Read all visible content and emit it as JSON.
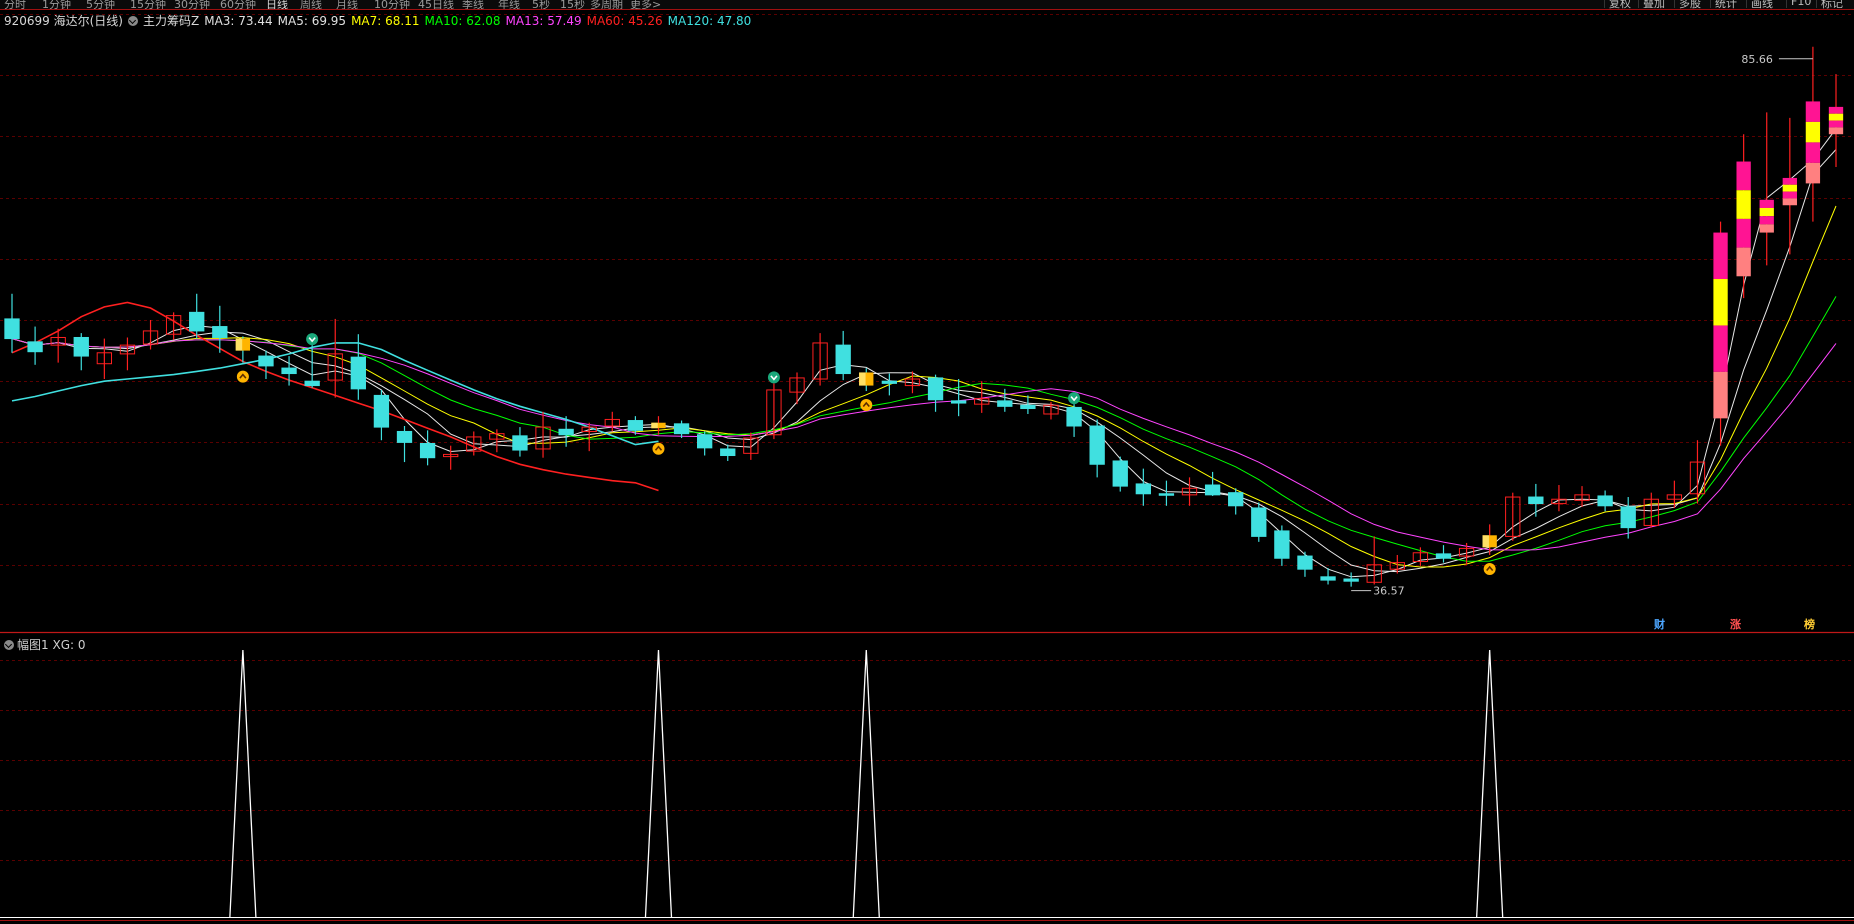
{
  "toolbar": {
    "periods": [
      "分时",
      "1分钟",
      "5分钟",
      "15分钟",
      "30分钟",
      "60分钟",
      "日线",
      "周线",
      "月线",
      "10分钟",
      "45日线",
      "季线",
      "年线",
      "5秒",
      "15秒",
      "多周期",
      "更多>"
    ],
    "active_period": "日线",
    "right_buttons": [
      "复权",
      "叠加",
      "多股",
      "统计",
      "画线",
      "F10",
      "标记"
    ]
  },
  "legend": {
    "stock": "920699 海达尔(日线)",
    "indicator": "主力筹码Z",
    "ma": [
      {
        "label": "MA3: 73.44",
        "color": "#e0e0e0"
      },
      {
        "label": "MA5: 69.95",
        "color": "#e0e0e0"
      },
      {
        "label": "MA7: 68.11",
        "color": "#ffff00"
      },
      {
        "label": "MA10: 62.08",
        "color": "#00ff00"
      },
      {
        "label": "MA13: 57.49",
        "color": "#ff44ff"
      },
      {
        "label": "MA60: 45.26",
        "color": "#ff2020"
      },
      {
        "label": "MA120: 47.80",
        "color": "#40e0e0"
      }
    ]
  },
  "sub_legend": {
    "title": "幅图1",
    "value": "XG: 0"
  },
  "tags": [
    {
      "text": "财",
      "color": "#4da6ff"
    },
    {
      "text": "涨",
      "color": "#ff5050"
    },
    {
      "text": "榜",
      "color": "#ffcc33"
    }
  ],
  "chart_data": [
    {
      "type": "candlestick",
      "title": "920699 海达尔(日线)",
      "ylim": [
        33,
        89
      ],
      "max_label": "85.66",
      "min_label": "36.57",
      "series": [
        {
          "name": "MA60",
          "color": "#ff2020",
          "values": [
            58.0,
            58.9,
            60.0,
            61.3,
            62.2,
            62.6,
            62.1,
            60.9,
            59.6,
            58.4,
            57.2,
            56.3,
            55.5,
            54.8,
            54.1,
            53.4,
            52.7,
            51.9,
            51.1,
            50.3,
            49.4,
            48.5,
            47.8,
            47.3,
            46.9,
            46.6,
            46.3,
            46.1,
            45.4
          ]
        },
        {
          "name": "MA120",
          "color": "#40e0e0",
          "values": [
            53.6,
            54.0,
            54.5,
            55.0,
            55.4,
            55.6,
            55.8,
            56.0,
            56.3,
            56.6,
            57.0,
            57.4,
            57.9,
            58.5,
            58.9,
            58.9,
            58.3,
            57.3,
            56.4,
            55.5,
            54.6,
            53.8,
            53.1,
            52.5,
            51.9,
            51.2,
            50.4,
            49.6,
            49.9
          ]
        }
      ],
      "candles": [
        {
          "o": 61.1,
          "h": 63.4,
          "l": 58.0,
          "c": 59.3
        },
        {
          "o": 59.0,
          "h": 60.4,
          "l": 56.9,
          "c": 58.1
        },
        {
          "o": 58.7,
          "h": 60.2,
          "l": 57.1,
          "c": 59.4
        },
        {
          "o": 59.4,
          "h": 59.8,
          "l": 56.4,
          "c": 57.7
        },
        {
          "o": 57.0,
          "h": 59.3,
          "l": 55.6,
          "c": 58.0
        },
        {
          "o": 57.9,
          "h": 59.4,
          "l": 56.4,
          "c": 58.7
        },
        {
          "o": 58.8,
          "h": 61.0,
          "l": 58.3,
          "c": 60.0
        },
        {
          "o": 59.7,
          "h": 61.7,
          "l": 59.2,
          "c": 61.4
        },
        {
          "o": 61.7,
          "h": 63.4,
          "l": 59.3,
          "c": 60.0
        },
        {
          "o": 60.4,
          "h": 62.3,
          "l": 58.0,
          "c": 59.4
        },
        {
          "o": 59.3,
          "h": 59.5,
          "l": 57.1,
          "c": 58.2
        },
        {
          "o": 57.7,
          "h": 58.2,
          "l": 55.6,
          "c": 56.8
        },
        {
          "o": 56.6,
          "h": 57.7,
          "l": 55.0,
          "c": 56.1
        },
        {
          "o": 55.4,
          "h": 58.7,
          "l": 54.8,
          "c": 55.0
        },
        {
          "o": 55.5,
          "h": 61.1,
          "l": 53.9,
          "c": 57.9
        },
        {
          "o": 57.6,
          "h": 59.7,
          "l": 53.7,
          "c": 54.7
        },
        {
          "o": 54.1,
          "h": 54.6,
          "l": 50.0,
          "c": 51.2
        },
        {
          "o": 50.8,
          "h": 51.3,
          "l": 48.0,
          "c": 49.8
        },
        {
          "o": 49.7,
          "h": 50.9,
          "l": 47.7,
          "c": 48.4
        },
        {
          "o": 48.5,
          "h": 49.5,
          "l": 47.3,
          "c": 48.7
        },
        {
          "o": 49.0,
          "h": 50.8,
          "l": 48.6,
          "c": 50.3
        },
        {
          "o": 50.1,
          "h": 51.0,
          "l": 48.9,
          "c": 50.6
        },
        {
          "o": 50.4,
          "h": 51.2,
          "l": 48.5,
          "c": 49.1
        },
        {
          "o": 49.2,
          "h": 52.6,
          "l": 48.4,
          "c": 51.2
        },
        {
          "o": 51.0,
          "h": 52.2,
          "l": 49.4,
          "c": 50.5
        },
        {
          "o": 50.8,
          "h": 51.6,
          "l": 49.0,
          "c": 51.2
        },
        {
          "o": 51.3,
          "h": 52.6,
          "l": 50.8,
          "c": 51.9
        },
        {
          "o": 51.8,
          "h": 52.2,
          "l": 50.5,
          "c": 50.9
        },
        {
          "o": 51.1,
          "h": 52.2,
          "l": 50.5,
          "c": 51.6
        },
        {
          "o": 51.5,
          "h": 51.8,
          "l": 50.2,
          "c": 50.6
        },
        {
          "o": 50.5,
          "h": 50.8,
          "l": 48.6,
          "c": 49.3
        },
        {
          "o": 49.2,
          "h": 49.6,
          "l": 48.1,
          "c": 48.6
        },
        {
          "o": 48.8,
          "h": 50.7,
          "l": 48.2,
          "c": 50.2
        },
        {
          "o": 50.5,
          "h": 55.2,
          "l": 50.1,
          "c": 54.6
        },
        {
          "o": 54.4,
          "h": 56.2,
          "l": 53.3,
          "c": 55.7
        },
        {
          "o": 55.6,
          "h": 59.8,
          "l": 55.0,
          "c": 58.9
        },
        {
          "o": 58.7,
          "h": 60.0,
          "l": 55.5,
          "c": 56.1
        },
        {
          "o": 56.2,
          "h": 56.6,
          "l": 54.5,
          "c": 55.0
        },
        {
          "o": 55.4,
          "h": 56.1,
          "l": 54.1,
          "c": 55.2
        },
        {
          "o": 55.0,
          "h": 56.3,
          "l": 54.3,
          "c": 55.6
        },
        {
          "o": 55.7,
          "h": 56.0,
          "l": 52.6,
          "c": 53.7
        },
        {
          "o": 53.6,
          "h": 55.6,
          "l": 52.2,
          "c": 53.4
        },
        {
          "o": 53.3,
          "h": 55.4,
          "l": 52.5,
          "c": 53.8
        },
        {
          "o": 53.6,
          "h": 54.7,
          "l": 52.6,
          "c": 53.1
        },
        {
          "o": 53.2,
          "h": 54.1,
          "l": 52.4,
          "c": 52.9
        },
        {
          "o": 52.4,
          "h": 53.5,
          "l": 51.9,
          "c": 53.2
        },
        {
          "o": 53.0,
          "h": 53.3,
          "l": 50.3,
          "c": 51.3
        },
        {
          "o": 51.3,
          "h": 51.9,
          "l": 46.6,
          "c": 47.8
        },
        {
          "o": 48.1,
          "h": 48.5,
          "l": 45.3,
          "c": 45.8
        },
        {
          "o": 46.0,
          "h": 47.4,
          "l": 44.0,
          "c": 45.1
        },
        {
          "o": 45.1,
          "h": 46.3,
          "l": 44.0,
          "c": 45.0
        },
        {
          "o": 45.0,
          "h": 46.6,
          "l": 44.0,
          "c": 45.6
        },
        {
          "o": 45.9,
          "h": 47.1,
          "l": 44.9,
          "c": 45.0
        },
        {
          "o": 45.2,
          "h": 45.6,
          "l": 43.2,
          "c": 44.0
        },
        {
          "o": 43.8,
          "h": 44.3,
          "l": 40.7,
          "c": 41.2
        },
        {
          "o": 41.7,
          "h": 42.2,
          "l": 38.5,
          "c": 39.2
        },
        {
          "o": 39.4,
          "h": 39.8,
          "l": 37.5,
          "c": 38.2
        },
        {
          "o": 37.5,
          "h": 38.3,
          "l": 36.8,
          "c": 37.2
        },
        {
          "o": 37.3,
          "h": 37.9,
          "l": 36.6,
          "c": 37.1
        },
        {
          "o": 37.0,
          "h": 41.2,
          "l": 36.8,
          "c": 38.6
        },
        {
          "o": 38.2,
          "h": 39.5,
          "l": 37.8,
          "c": 38.8
        },
        {
          "o": 38.9,
          "h": 40.2,
          "l": 38.5,
          "c": 39.7
        },
        {
          "o": 39.6,
          "h": 40.4,
          "l": 38.8,
          "c": 39.2
        },
        {
          "o": 39.4,
          "h": 40.6,
          "l": 38.6,
          "c": 40.1
        },
        {
          "o": 40.2,
          "h": 42.3,
          "l": 39.5,
          "c": 41.3
        },
        {
          "o": 41.2,
          "h": 45.2,
          "l": 40.8,
          "c": 44.8
        },
        {
          "o": 44.8,
          "h": 46.0,
          "l": 43.0,
          "c": 44.2
        },
        {
          "o": 44.2,
          "h": 45.9,
          "l": 43.5,
          "c": 44.6
        },
        {
          "o": 44.5,
          "h": 45.8,
          "l": 43.9,
          "c": 45.0
        },
        {
          "o": 44.9,
          "h": 45.4,
          "l": 43.5,
          "c": 44.0
        },
        {
          "o": 43.9,
          "h": 44.8,
          "l": 41.0,
          "c": 42.0
        },
        {
          "o": 42.2,
          "h": 45.2,
          "l": 42.0,
          "c": 44.6
        },
        {
          "o": 44.6,
          "h": 46.3,
          "l": 43.8,
          "c": 45.0
        },
        {
          "o": 45.1,
          "h": 50.0,
          "l": 44.2,
          "c": 48.0
        },
        {
          "o": 52.0,
          "h": 70.0,
          "l": 49.5,
          "c": 69.0
        },
        {
          "o": 65.0,
          "h": 78.0,
          "l": 63.0,
          "c": 75.5
        },
        {
          "o": 69.0,
          "h": 80.0,
          "l": 66.0,
          "c": 72.0
        },
        {
          "o": 71.5,
          "h": 79.5,
          "l": 67.0,
          "c": 74.0
        },
        {
          "o": 73.5,
          "h": 86.0,
          "l": 70.0,
          "c": 81.0
        },
        {
          "o": 78.0,
          "h": 83.5,
          "l": 75.0,
          "c": 80.5
        }
      ]
    },
    {
      "type": "line",
      "title": "幅图1",
      "ylim": [
        0,
        1
      ],
      "series": [
        {
          "name": "XG",
          "color": "#ffffff",
          "spikes_at_candle": [
            10,
            28,
            37,
            64
          ]
        }
      ]
    }
  ]
}
